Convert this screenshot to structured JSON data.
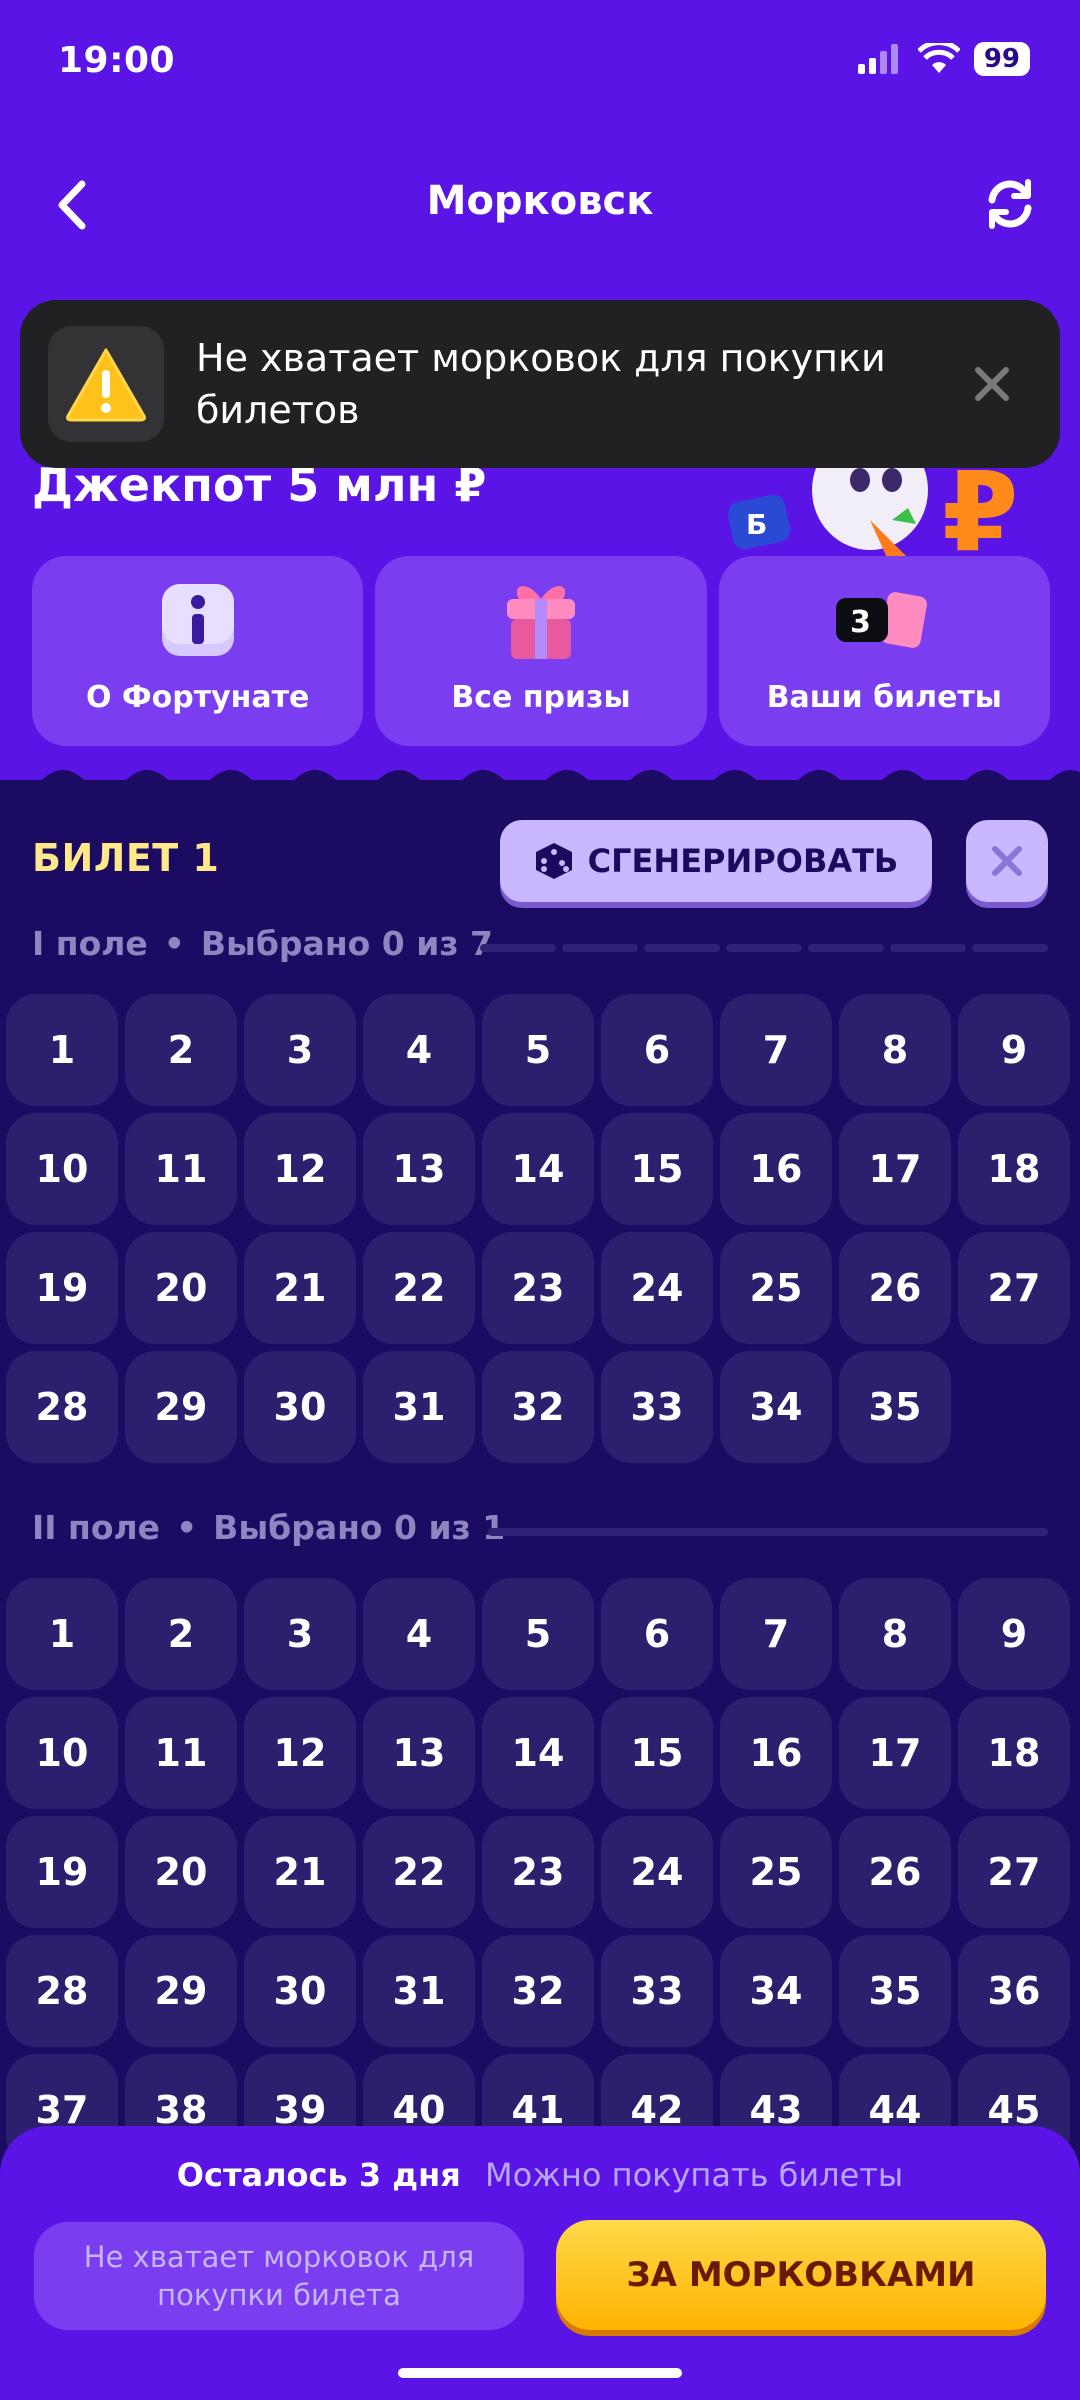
{
  "status_bar": {
    "time": "19:00",
    "battery": "99"
  },
  "header": {
    "title": "Морковск"
  },
  "toast": {
    "text": "Не хватает морковок для покупки билетов"
  },
  "jackpot": {
    "text": "Джекпот 5 млн ₽"
  },
  "cards": [
    {
      "label": "О Фортунате",
      "icon": "info-icon"
    },
    {
      "label": "Все призы",
      "icon": "gift-icon"
    },
    {
      "label": "Ваши билеты",
      "icon": "tickets-icon",
      "badge": "3"
    }
  ],
  "ticket": {
    "title": "БИЛЕТ 1",
    "generate_label": "СГЕНЕРИРОВАТЬ",
    "field1": {
      "name": "I поле",
      "selected": "Выбрано 0 из 7",
      "numbers": [
        "1",
        "2",
        "3",
        "4",
        "5",
        "6",
        "7",
        "8",
        "9",
        "10",
        "11",
        "12",
        "13",
        "14",
        "15",
        "16",
        "17",
        "18",
        "19",
        "20",
        "21",
        "22",
        "23",
        "24",
        "25",
        "26",
        "27",
        "28",
        "29",
        "30",
        "31",
        "32",
        "33",
        "34",
        "35"
      ]
    },
    "field2": {
      "name": "II поле",
      "selected": "Выбрано 0 из 1",
      "numbers": [
        "1",
        "2",
        "3",
        "4",
        "5",
        "6",
        "7",
        "8",
        "9",
        "10",
        "11",
        "12",
        "13",
        "14",
        "15",
        "16",
        "17",
        "18",
        "19",
        "20",
        "21",
        "22",
        "23",
        "24",
        "25",
        "26",
        "27",
        "28",
        "29",
        "30",
        "31",
        "32",
        "33",
        "34",
        "35",
        "36",
        "37",
        "38",
        "39",
        "40",
        "41",
        "42",
        "43",
        "44",
        "45"
      ]
    }
  },
  "bottom": {
    "remaining": "Осталось 3 дня",
    "status": "Можно покупать билеты",
    "disabled_label": "Не хватает морковок для покупки билета",
    "cta_label": "ЗА МОРКОВКАМИ"
  },
  "colors": {
    "primary": "#5a14e6",
    "dark": "#1b0b63",
    "cell": "#2c206e",
    "accent": "#ffc21a",
    "ticket_title": "#ffe88a"
  }
}
